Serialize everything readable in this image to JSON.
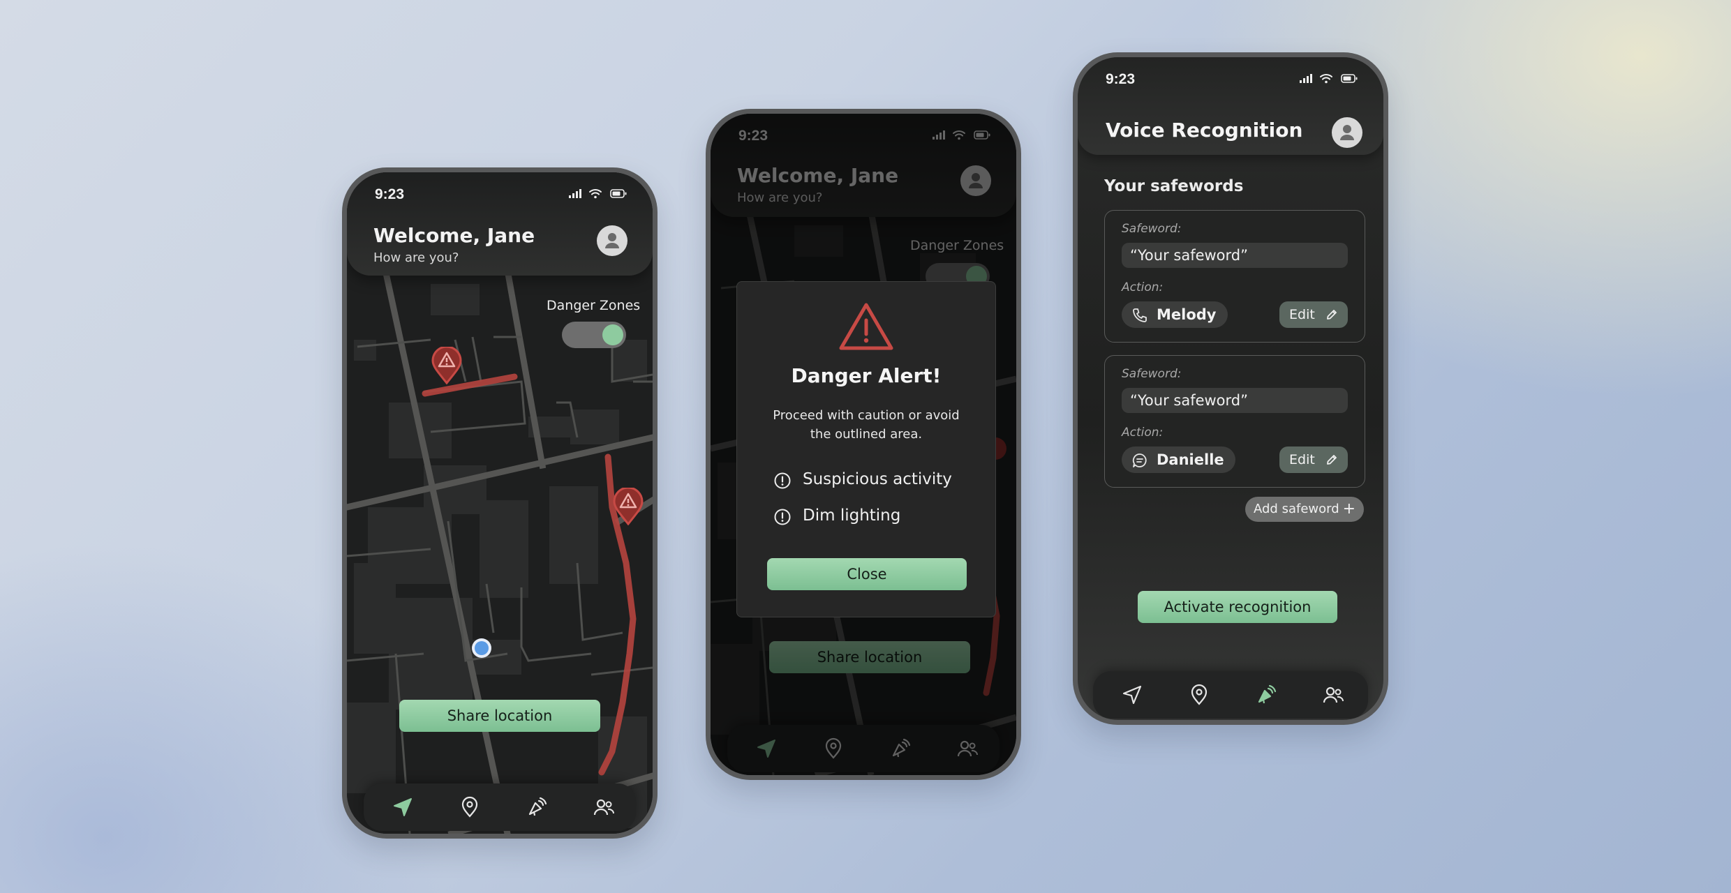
{
  "status_bar": {
    "time": "9:23"
  },
  "home": {
    "title": "Welcome, Jane",
    "subtitle": "How are you?",
    "danger_zones_label": "Danger Zones",
    "danger_zones_on": true,
    "share_label": "Share location"
  },
  "alert": {
    "title": "Danger Alert!",
    "message": "Proceed with caution or avoid the outlined area.",
    "reasons": [
      "Suspicious activity",
      "Dim lighting"
    ],
    "close_label": "Close"
  },
  "voice": {
    "title": "Voice Recognition",
    "section_title": "Your safewords",
    "safeword_label": "Safeword:",
    "action_label": "Action:",
    "edit_label": "Edit",
    "cards": [
      {
        "safeword": "“Your safeword”",
        "contact": "Melody",
        "action_icon": "phone-icon"
      },
      {
        "safeword": "“Your safeword”",
        "contact": "Danielle",
        "action_icon": "message-icon"
      }
    ],
    "add_label": "Add safeword",
    "add_symbol": "+",
    "activate_label": "Activate recognition"
  },
  "nav": {
    "items": [
      "navigate-icon",
      "location-pin-icon",
      "voice-recognition-icon",
      "contacts-icon"
    ],
    "active_color": "#8ecb9f"
  },
  "colors": {
    "accent": "#8ecb9f",
    "danger": "#c74a45"
  }
}
